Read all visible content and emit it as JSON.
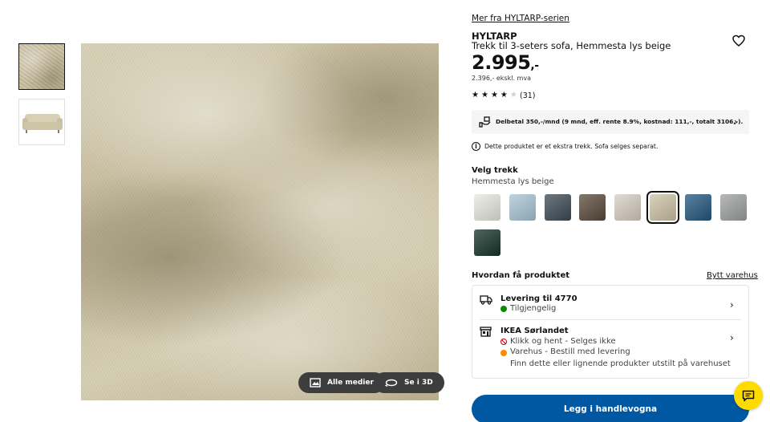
{
  "gallery": {
    "thumbnails": [
      {
        "name": "fabric-closeup",
        "selected": true
      },
      {
        "name": "sofa-full-view",
        "selected": false
      }
    ],
    "buttons": {
      "all_media": "Alle medier",
      "view_3d": "Se i 3D"
    }
  },
  "product": {
    "series_link": "Mer fra HYLTARP-serien",
    "name": "HYLTARP",
    "description": "Trekk til 3-seters sofa, Hemmesta lys beige",
    "price": "2.995",
    "price_suffix": ",-",
    "price_excl_vat": "2.396,- ekskl. mva",
    "rating": 3.5,
    "rating_max": 5,
    "review_count": "(31)"
  },
  "financing": {
    "text": "Delbetal 350,-/mnd (9 mnd, eff. rente 8.9%, kostnad: 111,-, totalt 3106,-)."
  },
  "notice": {
    "text": "Dette produktet er et ekstra trekk. Sofa selges separat."
  },
  "cover_selector": {
    "label": "Velg trekk",
    "selected_value": "Hemmesta lys beige",
    "swatches": [
      {
        "color": "#e9e9e1",
        "selected": false
      },
      {
        "color": "#a9c6d6",
        "selected": false
      },
      {
        "color": "#3d4a55",
        "selected": false
      },
      {
        "color": "#5a4a3c",
        "selected": false
      },
      {
        "color": "#d8cfc2",
        "selected": false
      },
      {
        "color": "#cdc3a6",
        "selected": true
      },
      {
        "color": "#24577e",
        "selected": false
      },
      {
        "color": "#9fa1a1",
        "selected": false
      },
      {
        "color": "#163328",
        "selected": false
      }
    ]
  },
  "availability": {
    "title": "Hvordan få produktet",
    "change_store": "Bytt varehus",
    "delivery": {
      "title": "Levering til 4770",
      "status": "Tilgjengelig",
      "status_color": "#0a8a00"
    },
    "store": {
      "title": "IKEA Sørlandet",
      "click_collect": "Klikk og hent - Selges ikke",
      "click_collect_color": "#cc0008",
      "warehouse": "Varehus - Bestill med levering",
      "warehouse_color": "#ff8a00",
      "note": "Finn dette eller lignende produkter utstilt på varehuset"
    }
  },
  "cta": {
    "add_to_cart": "Legg i handlevogna"
  },
  "colors": {
    "brand_blue": "#0058a3",
    "chat_yellow": "#ffdb00"
  }
}
